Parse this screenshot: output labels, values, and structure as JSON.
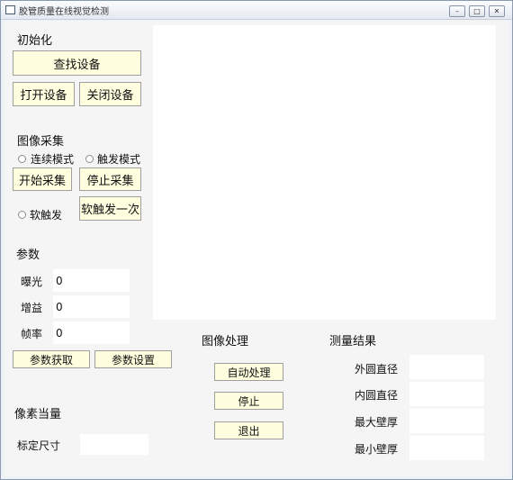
{
  "window": {
    "title": "胶管质量在线视觉检测",
    "min": "–",
    "max": "□",
    "close": "✕"
  },
  "init": {
    "title": "初始化",
    "find": "查找设备",
    "open": "打开设备",
    "close": "关闭设备"
  },
  "capture": {
    "title": "图像采集",
    "continuous": "连续模式",
    "trigger": "触发模式",
    "start": "开始采集",
    "stop": "停止采集",
    "soft_trigger": "软触发",
    "soft_once": "软触发一次"
  },
  "params": {
    "title": "参数",
    "exposure_label": "曝光",
    "exposure": "0",
    "gain_label": "增益",
    "gain": "0",
    "fps_label": "帧率",
    "fps": "0",
    "get": "参数获取",
    "set": "参数设置"
  },
  "pixel": {
    "title": "像素当量",
    "calib_label": "标定尺寸",
    "calib": ""
  },
  "processing": {
    "title": "图像处理",
    "auto": "自动处理",
    "stop": "停止",
    "exit": "退出"
  },
  "results": {
    "title": "测量结果",
    "outer": "外圆直径",
    "inner": "内圆直径",
    "max_wall": "最大壁厚",
    "min_wall": "最小壁厚",
    "outer_val": "",
    "inner_val": "",
    "max_wall_val": "",
    "min_wall_val": ""
  }
}
